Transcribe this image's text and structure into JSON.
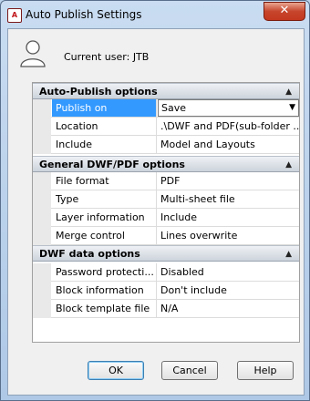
{
  "window": {
    "title": "Auto Publish Settings",
    "app_icon": "A",
    "close_glyph": "✕"
  },
  "user": {
    "label": "Current user: JTB"
  },
  "sections": {
    "auto_publish": {
      "title": "Auto-Publish options",
      "rows": [
        {
          "label": "Publish on",
          "value": "Save"
        },
        {
          "label": "Location",
          "value": ".\\DWF and PDF(sub-folder ..."
        },
        {
          "label": "Include",
          "value": "Model and Layouts"
        }
      ]
    },
    "general": {
      "title": "General DWF/PDF options",
      "rows": [
        {
          "label": "File format",
          "value": "PDF"
        },
        {
          "label": "Type",
          "value": "Multi-sheet file"
        },
        {
          "label": "Layer information",
          "value": "Include"
        },
        {
          "label": "Merge control",
          "value": "Lines overwrite"
        }
      ]
    },
    "dwf_data": {
      "title": "DWF data options",
      "rows": [
        {
          "label": "Password protecti...",
          "value": "Disabled"
        },
        {
          "label": "Block information",
          "value": "Don't include"
        },
        {
          "label": "Block template file",
          "value": "N/A"
        }
      ]
    }
  },
  "collapse_glyph": "▲",
  "dropdown_glyph": "▼",
  "buttons": {
    "ok": "OK",
    "cancel": "Cancel",
    "help": "Help"
  },
  "colors": {
    "selection": "#3399ff",
    "close_button": "#c4381f"
  }
}
